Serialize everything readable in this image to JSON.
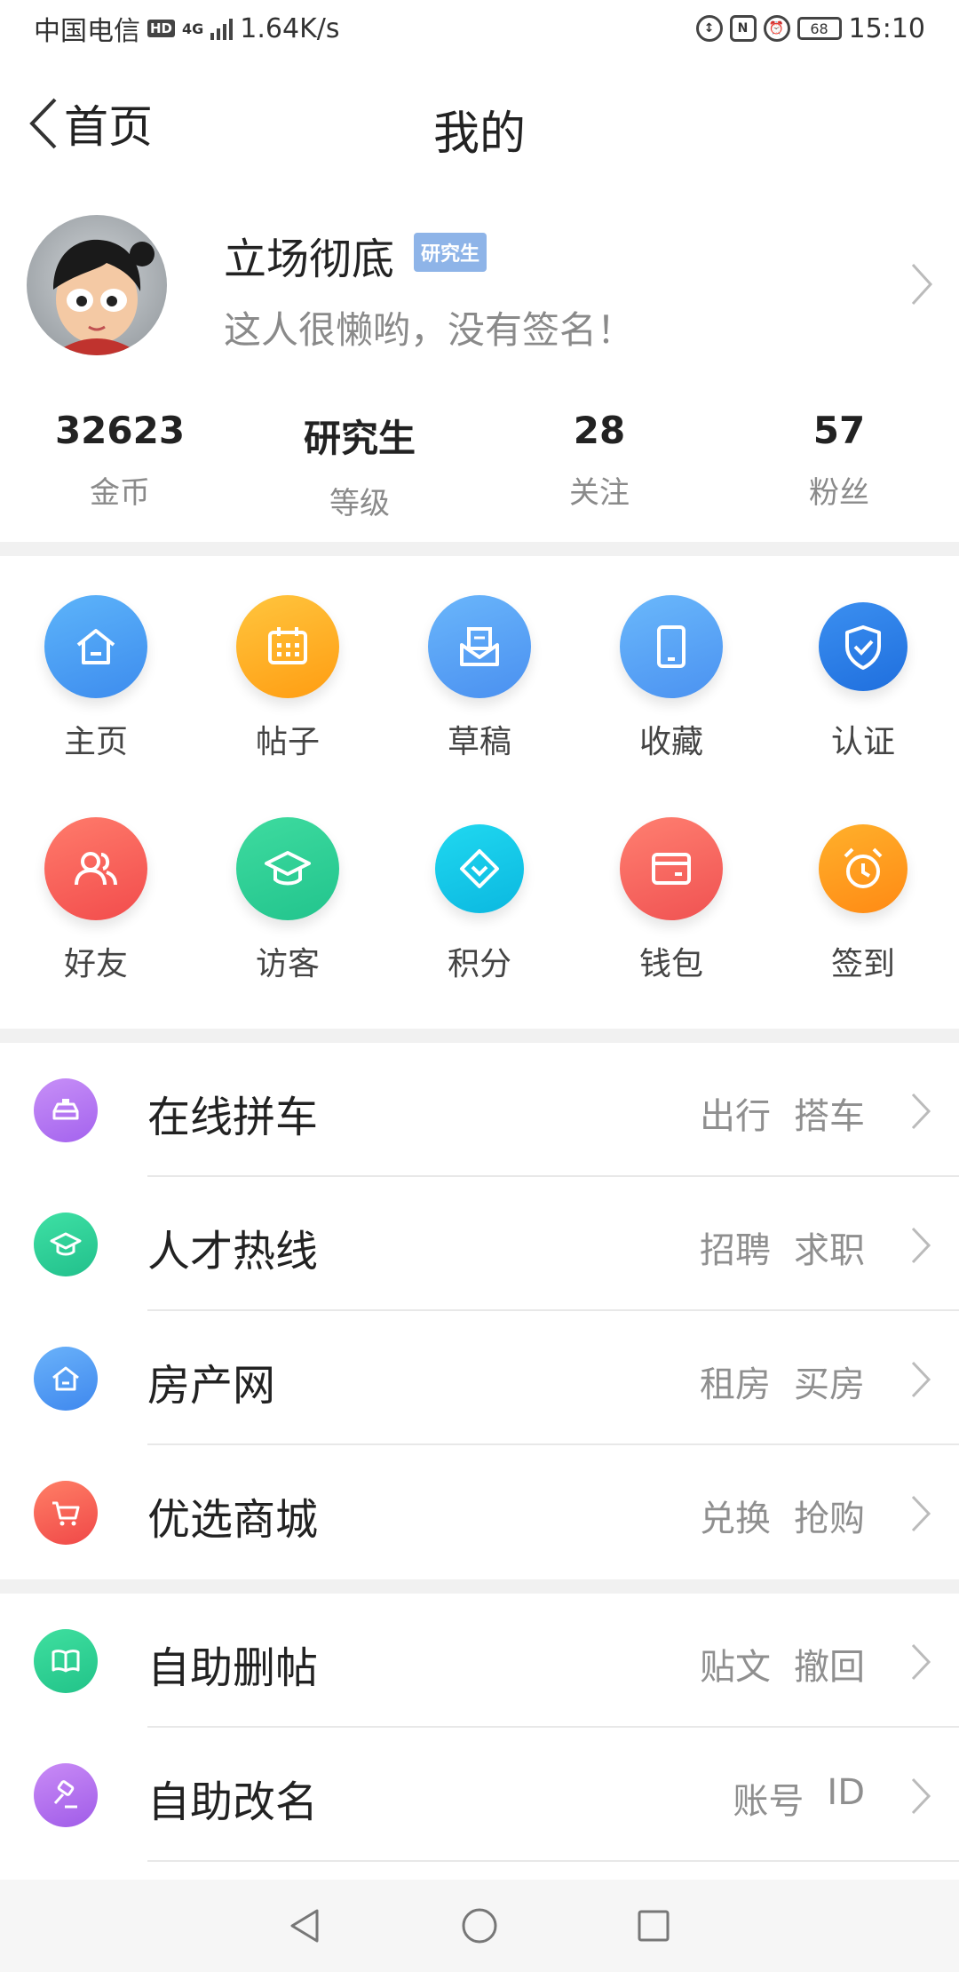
{
  "status_bar": {
    "carrier": "中国电信",
    "hd": "HD",
    "network": "4G",
    "speed": "1.64K/s",
    "nfc": "N",
    "battery": "68",
    "time": "15:10"
  },
  "nav": {
    "back_label": "首页",
    "title": "我的"
  },
  "profile": {
    "name": "立场彻底",
    "badge": "研究生",
    "signature": "这人很懒哟，没有签名！"
  },
  "stats": [
    {
      "value": "32623",
      "label": "金币"
    },
    {
      "value": "研究生",
      "label": "等级"
    },
    {
      "value": "28",
      "label": "关注"
    },
    {
      "value": "57",
      "label": "粉丝"
    }
  ],
  "grid": [
    {
      "label": "主页",
      "icon": "home-icon",
      "color": "#4aa3f5"
    },
    {
      "label": "帖子",
      "icon": "calendar-icon",
      "color": "#ffb325"
    },
    {
      "label": "草稿",
      "icon": "mail-draft-icon",
      "color": "#5aa8f7"
    },
    {
      "label": "收藏",
      "icon": "tablet-icon",
      "color": "#5eaaf8"
    },
    {
      "label": "认证",
      "icon": "shield-check-icon",
      "color": "#2f7fe8"
    },
    {
      "label": "好友",
      "icon": "friends-icon",
      "color": "#f7605a"
    },
    {
      "label": "访客",
      "icon": "graduation-cap-icon",
      "color": "#36d39a"
    },
    {
      "label": "积分",
      "icon": "diamond-icon",
      "color": "#1cc8e8"
    },
    {
      "label": "钱包",
      "icon": "wallet-icon",
      "color": "#f86c66"
    },
    {
      "label": "签到",
      "icon": "alarm-clock-icon",
      "color": "#ffa620"
    }
  ],
  "list_group1": [
    {
      "title": "在线拼车",
      "tags": [
        "出行",
        "搭车"
      ],
      "icon": "taxi-icon",
      "color": "#b77cf3"
    },
    {
      "title": "人才热线",
      "tags": [
        "招聘",
        "求职"
      ],
      "icon": "graduation-cap-icon",
      "color": "#33cf9a"
    },
    {
      "title": "房产网",
      "tags": [
        "租房",
        "买房"
      ],
      "icon": "house-icon",
      "color": "#559df5"
    },
    {
      "title": "优选商城",
      "tags": [
        "兑换",
        "抢购"
      ],
      "icon": "cart-icon",
      "color": "#f76058"
    }
  ],
  "list_group2": [
    {
      "title": "自助删帖",
      "tags": [
        "贴文",
        "撤回"
      ],
      "icon": "book-icon",
      "color": "#33cf95"
    },
    {
      "title": "自助改名",
      "tags": [
        "账号",
        "ID"
      ],
      "icon": "gavel-icon",
      "color": "#b474f2"
    }
  ]
}
